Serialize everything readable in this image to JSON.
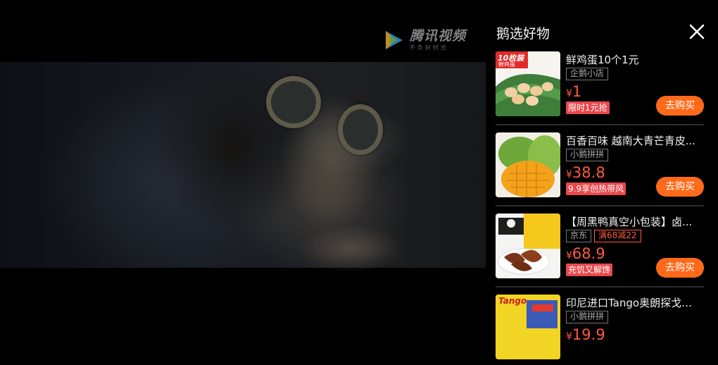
{
  "video": {
    "logo_text": "腾讯视频",
    "logo_sub": "不负好时光",
    "logo_icon": "tencent-video-play-icon"
  },
  "panel": {
    "title": "鹅选好物",
    "close_icon": "close-icon",
    "items": [
      {
        "name": "鲜鸡蛋10个1元",
        "shop": "企鹅小店",
        "promo": "",
        "currency": "¥",
        "price": "1",
        "badge": "限时1元抢",
        "buy_label": "去购买",
        "thumb_text": "10枚装",
        "thumb_sub": "鲜鸡蛋"
      },
      {
        "name": "百香百味 越南大青芒青皮...",
        "shop": "小鹅拼拼",
        "promo": "",
        "currency": "¥",
        "price": "38.8",
        "badge": "9.9享创热带风",
        "buy_label": "去购买"
      },
      {
        "name": "【周黑鸭真空小包装】卤...",
        "shop": "京东",
        "promo": "满68减22",
        "currency": "¥",
        "price": "68.9",
        "badge": "充饥又解馋",
        "buy_label": "去购买"
      },
      {
        "name": "印尼进口Tango奥朗探戈咔...",
        "shop": "小鹅拼拼",
        "promo": "",
        "currency": "¥",
        "price": "19.9",
        "thumb_text": "Tango"
      }
    ]
  },
  "colors": {
    "accent": "#ff6a1a",
    "price": "#ff5a3c",
    "badge": "#e8494d"
  }
}
